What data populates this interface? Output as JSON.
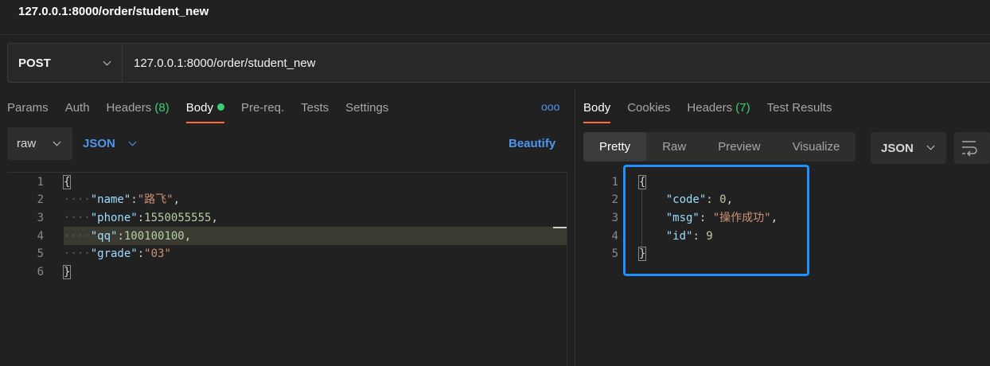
{
  "window": {
    "title": "127.0.0.1:8000/order/student_new"
  },
  "request": {
    "method": "POST",
    "url": "127.0.0.1:8000/order/student_new",
    "tabs": [
      {
        "label": "Params"
      },
      {
        "label": "Auth"
      },
      {
        "label": "Headers",
        "count": "(8)"
      },
      {
        "label": "Body",
        "active": true
      },
      {
        "label": "Pre-req."
      },
      {
        "label": "Tests"
      },
      {
        "label": "Settings"
      }
    ],
    "more_label": "ooo",
    "body_mode": "raw",
    "body_format": "JSON",
    "beautify_label": "Beautify",
    "line_numbers": [
      "1",
      "2",
      "3",
      "4",
      "5",
      "6"
    ],
    "code": {
      "l1": "{",
      "l2_key": "\"name\"",
      "l2_val": "\"路飞\"",
      "l3_key": "\"phone\"",
      "l3_val": "1550055555",
      "l4_key": "\"qq\"",
      "l4_val": "100100100",
      "l5_key": "\"grade\"",
      "l5_val": "\"03\"",
      "l6": "}"
    }
  },
  "response": {
    "tabs": [
      {
        "label": "Body",
        "active": true
      },
      {
        "label": "Cookies"
      },
      {
        "label": "Headers",
        "count": "(7)"
      },
      {
        "label": "Test Results"
      }
    ],
    "view_modes": [
      "Pretty",
      "Raw",
      "Preview",
      "Visualize"
    ],
    "format": "JSON",
    "line_numbers": [
      "1",
      "2",
      "3",
      "4",
      "5"
    ],
    "code": {
      "l1": "{",
      "l2_key": "\"code\"",
      "l2_val": "0",
      "l3_key": "\"msg\"",
      "l3_val": "\"操作成功\"",
      "l4_key": "\"id\"",
      "l4_val": "9",
      "l5": "}"
    }
  },
  "colors": {
    "accent_tab": "#ff6c37",
    "link_blue": "#4e95f0",
    "count_green": "#3ccf72",
    "highlight_box": "#1e90ff"
  }
}
